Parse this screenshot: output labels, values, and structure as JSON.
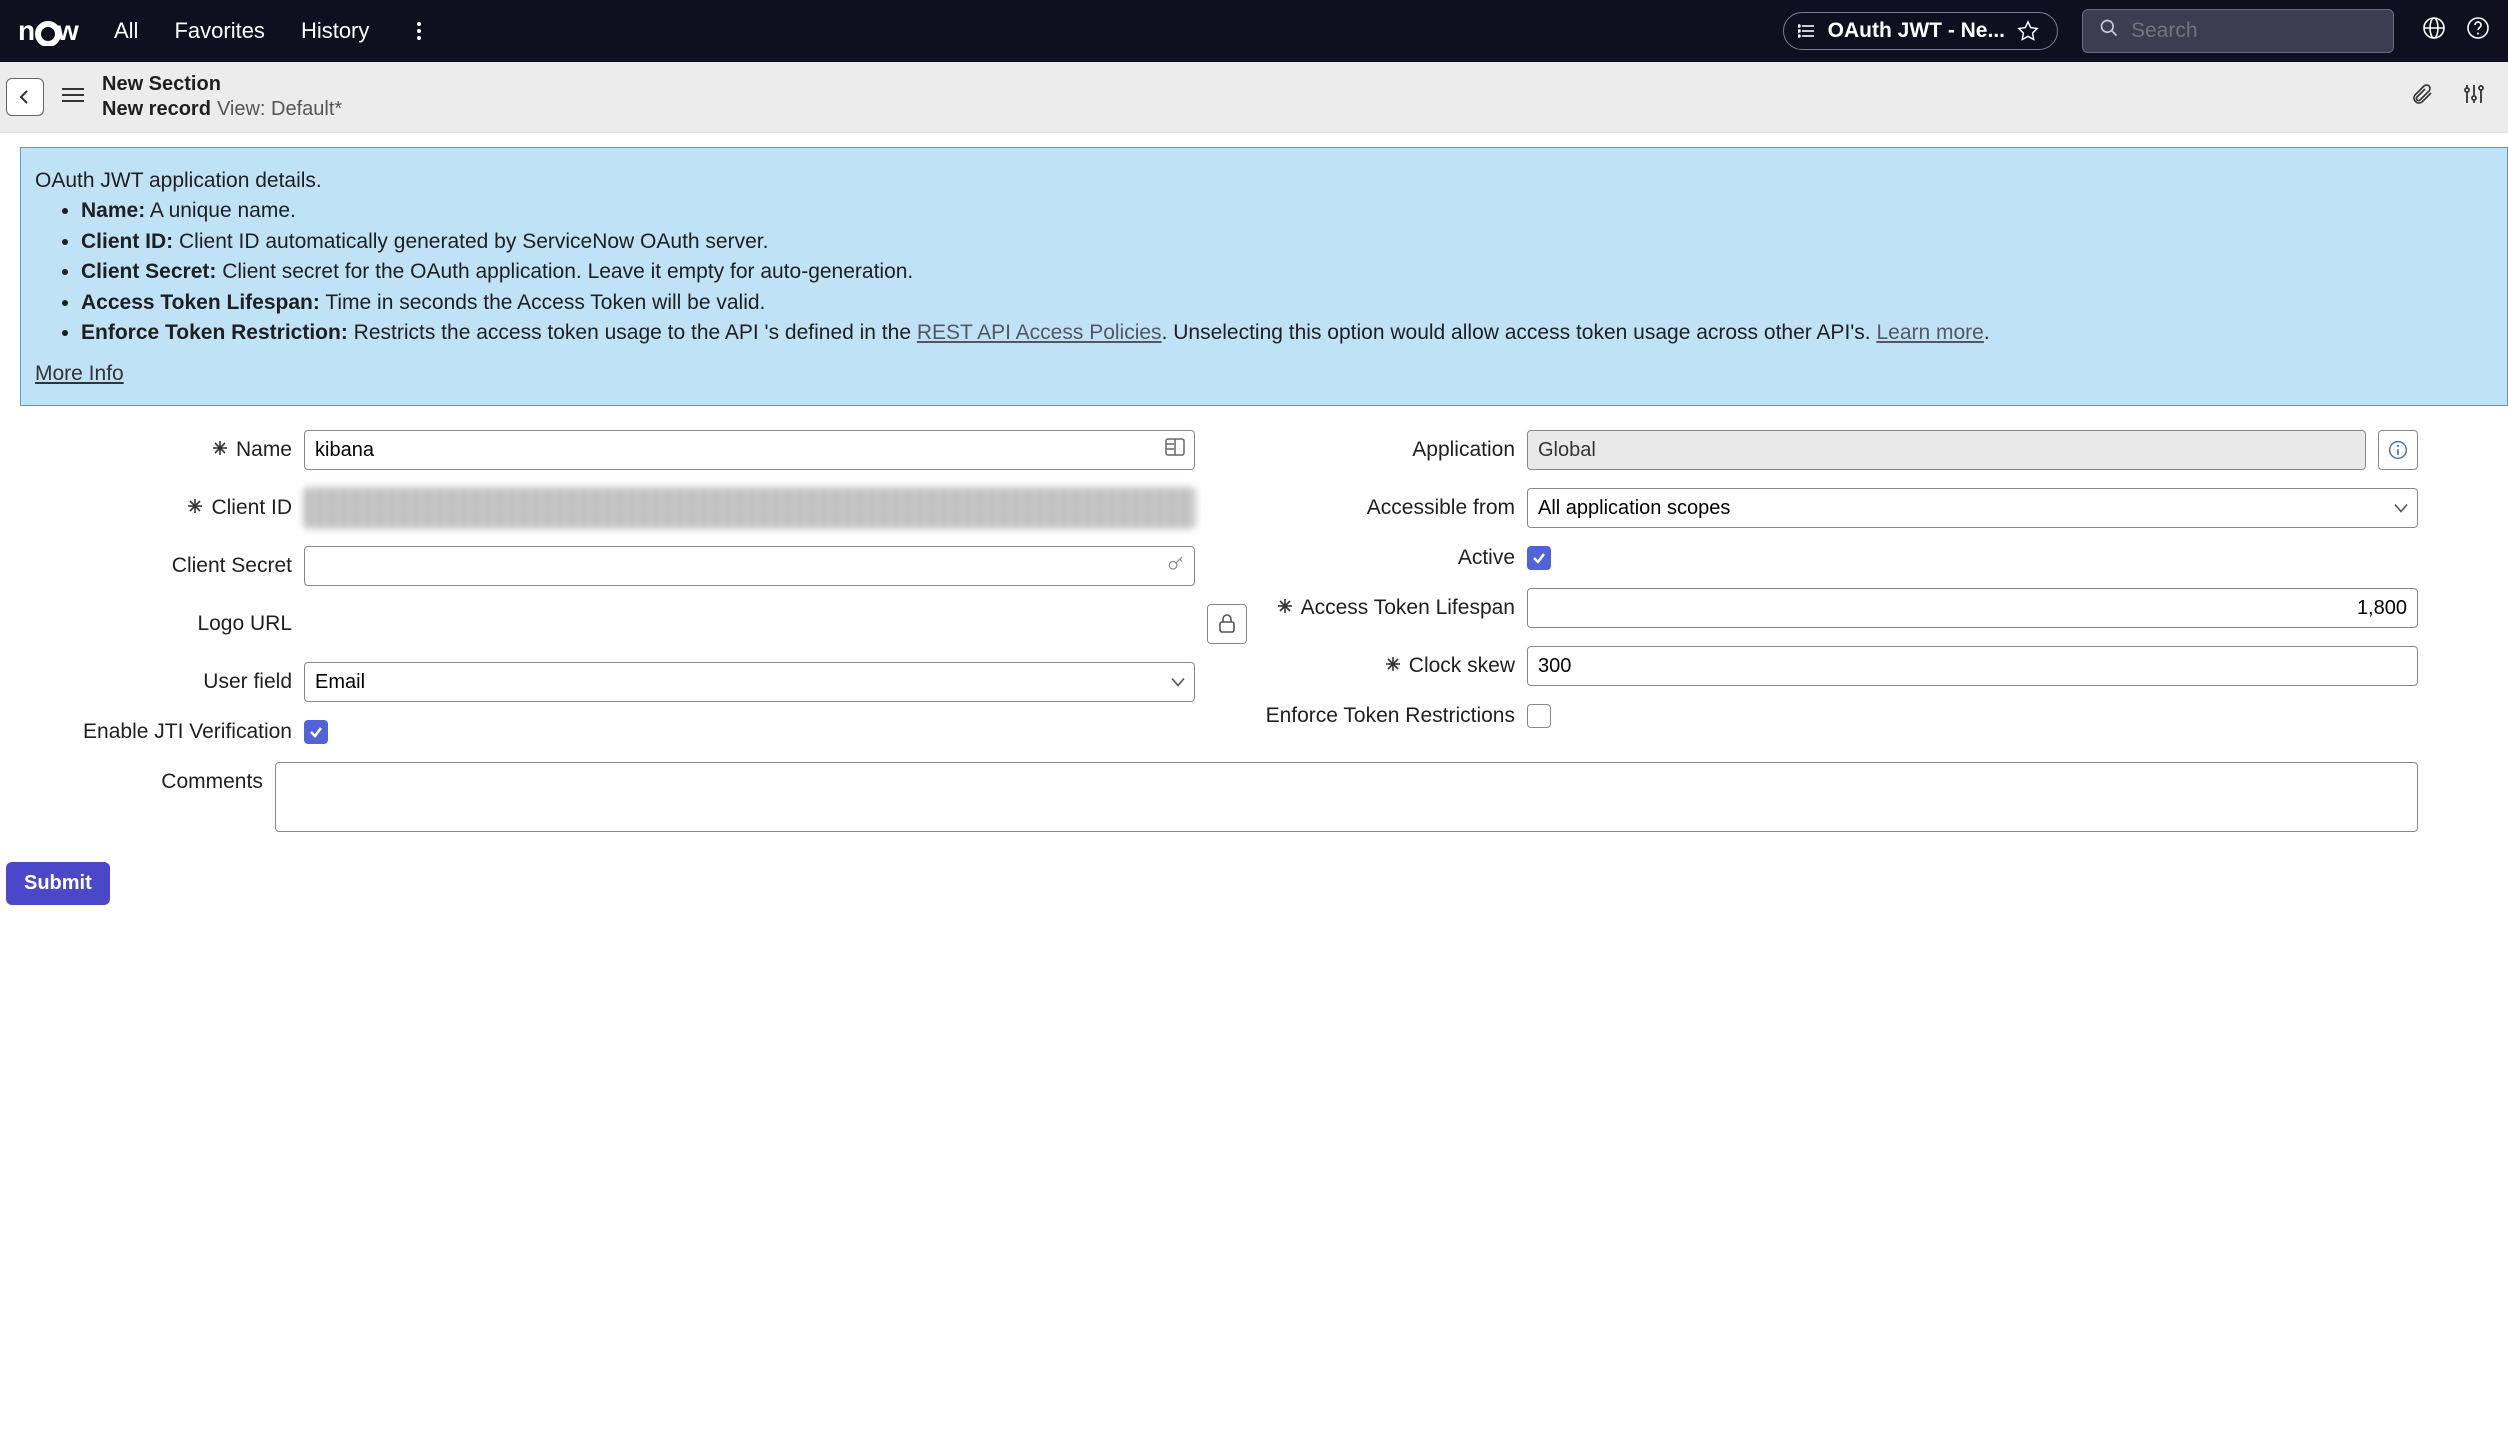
{
  "nav": {
    "logo_text": "now",
    "items": [
      "All",
      "Favorites",
      "History"
    ],
    "pill_title": "OAuth JWT - Ne...",
    "search_placeholder": "Search"
  },
  "subheader": {
    "line1": "New Section",
    "line2_record": "New record",
    "line2_view": "View: Default*"
  },
  "banner": {
    "intro": "OAuth JWT application details.",
    "items": [
      {
        "label": "Name:",
        "text": "A unique name."
      },
      {
        "label": "Client ID:",
        "text": "Client ID automatically generated by ServiceNow OAuth server."
      },
      {
        "label": "Client Secret:",
        "text": "Client secret for the OAuth application. Leave it empty for auto-generation."
      },
      {
        "label": "Access Token Lifespan:",
        "text": "Time in seconds the Access Token will be valid."
      }
    ],
    "enforce_label": "Enforce Token Restriction:",
    "enforce_pre": "Restricts the access token usage to the API 's defined in the ",
    "enforce_link": "REST API Access Policies",
    "enforce_post": ". Unselecting this option would allow access token usage across other API's. ",
    "learn_more": "Learn more",
    "more_info": "More Info"
  },
  "form": {
    "left": {
      "name_label": "Name",
      "name_value": "kibana",
      "client_id_label": "Client ID",
      "client_id_value": "redacted-client-id-value",
      "client_secret_label": "Client Secret",
      "client_secret_value": "",
      "logo_url_label": "Logo URL",
      "user_field_label": "User field",
      "user_field_value": "Email",
      "enable_jti_label": "Enable JTI Verification",
      "enable_jti_checked": true
    },
    "right": {
      "application_label": "Application",
      "application_value": "Global",
      "accessible_from_label": "Accessible from",
      "accessible_from_value": "All application scopes",
      "active_label": "Active",
      "active_checked": true,
      "access_token_lifespan_label": "Access Token Lifespan",
      "access_token_lifespan_value": "1,800",
      "clock_skew_label": "Clock skew",
      "clock_skew_value": "300",
      "enforce_label": "Enforce Token Restrictions",
      "enforce_checked": false
    },
    "comments_label": "Comments",
    "comments_value": ""
  },
  "actions": {
    "submit": "Submit"
  }
}
